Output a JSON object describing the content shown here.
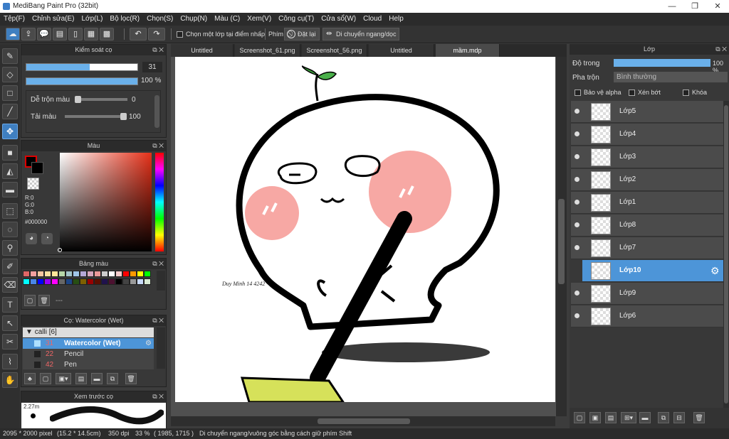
{
  "window": {
    "title": "MediBang Paint Pro (32bit)"
  },
  "menu": [
    "Tệp(F)",
    "Chỉnh sửa(E)",
    "Lớp(L)",
    "Bộ lọc(R)",
    "Chọn(S)",
    "Chụp(N)",
    "Màu (C)",
    "Xem(V)",
    "Công cụ(T)",
    "Cửa sổ(W)",
    "Cloud",
    "Help"
  ],
  "toolbar": {
    "select_layer_label": "Chọn một lớp tại điểm nhấp",
    "key_label": "Phím",
    "reset_label": "Đặt lại",
    "move_label": "Di chuyển ngang/dọc"
  },
  "brush_control": {
    "title": "Kiểm soát cọ",
    "size_value": "31",
    "opacity_value": "100 %",
    "blend_label": "Dễ trộn màu",
    "blend_value": "0",
    "refill_label": "Tải màu",
    "refill_value": "100"
  },
  "color": {
    "title": "Màu",
    "r": "R:0",
    "g": "G:0",
    "b": "B:0",
    "hex": "#000000"
  },
  "palette": {
    "title": "Bảng màu",
    "dash": "---",
    "colors": [
      "#e06666",
      "#f4a0a0",
      "#f6c6a0",
      "#f9e0a0",
      "#ffe599",
      "#b6d7a8",
      "#a2c4c9",
      "#9fc5e8",
      "#b4a7d6",
      "#d5a6bd",
      "#ea9999",
      "#cccccc",
      "#ffffff",
      "#f4cccc",
      "#ff0000",
      "#ff9900",
      "#ffff00",
      "#00ff00",
      "#00ffff",
      "#4a86e8",
      "#0000ff",
      "#9900ff",
      "#ff00ff",
      "#666666",
      "#1c4587",
      "#274e13",
      "#7f6000",
      "#990000",
      "#5b0f00",
      "#20124d",
      "#4c1130",
      "#000000",
      "#434343",
      "#999999",
      "#c9daf8",
      "#d9ead3"
    ]
  },
  "brushes": {
    "title": "Cọ: Watercolor (Wet)",
    "group": "calli [6]",
    "items": [
      {
        "size": "31",
        "name": "Watercolor (Wet)",
        "selected": true
      },
      {
        "size": "22",
        "name": "Pencil",
        "selected": false
      },
      {
        "size": "42",
        "name": "Pen",
        "selected": false
      }
    ]
  },
  "preview": {
    "title": "Xem trước cọ",
    "size": "2.27m"
  },
  "tabs": [
    {
      "label": "Untitled",
      "active": false
    },
    {
      "label": "Screenshot_61.png",
      "active": false
    },
    {
      "label": "Screenshot_56.png",
      "active": false
    },
    {
      "label": "Untitled",
      "active": false
    },
    {
      "label": "mầm.mdp",
      "active": true
    }
  ],
  "layers": {
    "title": "Lớp",
    "opacity_label": "Độ trong",
    "opacity_value": "100 %",
    "blend_label": "Pha trộn",
    "blend_value": "Bình thường",
    "protect_alpha": "Bảo vệ alpha",
    "clip": "Xén bớt",
    "lock": "Khóa",
    "items": [
      {
        "name": "Lớp5",
        "selected": false
      },
      {
        "name": "Lớp4",
        "selected": false
      },
      {
        "name": "Lớp3",
        "selected": false
      },
      {
        "name": "Lớp2",
        "selected": false
      },
      {
        "name": "Lớp1",
        "selected": false
      },
      {
        "name": "Lớp8",
        "selected": false
      },
      {
        "name": "Lớp7",
        "selected": false
      },
      {
        "name": "Lớp10",
        "selected": true
      },
      {
        "name": "Lớp9",
        "selected": false
      },
      {
        "name": "Lớp6",
        "selected": false
      }
    ]
  },
  "canvas": {
    "signature": "Duy Minh 14 4242"
  },
  "status": {
    "size": "2095 * 2000 pixel",
    "cm": "(15.2 * 14.5cm)",
    "dpi": "350 dpi",
    "zoom": "33 %",
    "coords": "( 1985, 1715 )",
    "hint": "Di chuyển ngang/vuông góc bằng cách giữ phím Shift"
  }
}
